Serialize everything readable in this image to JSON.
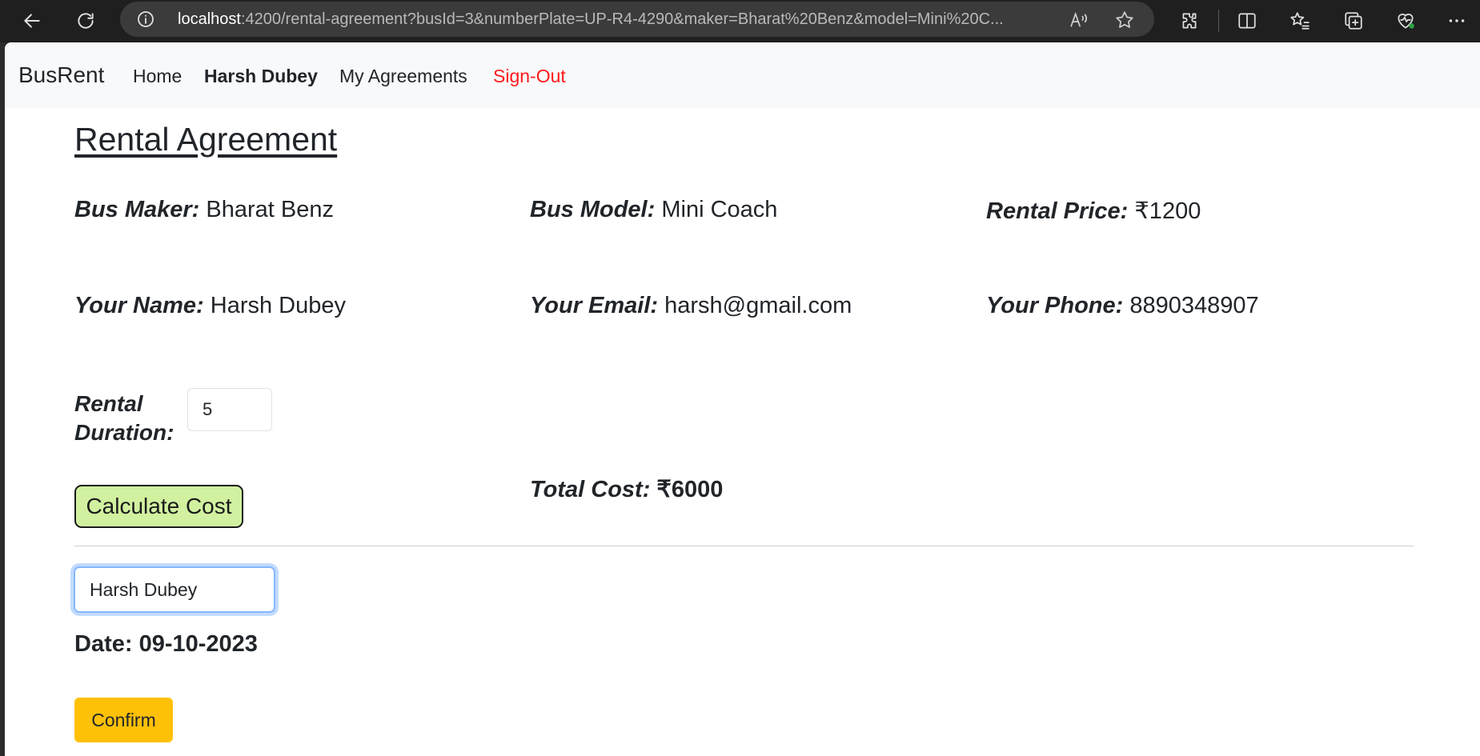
{
  "browser": {
    "url_host": "localhost",
    "url_rest": ":4200/rental-agreement?busId=3&numberPlate=UP-R4-4290&maker=Bharat%20Benz&model=Mini%20C..."
  },
  "navbar": {
    "brand": "BusRent",
    "home": "Home",
    "user": "Harsh Dubey",
    "agreements": "My Agreements",
    "signout": "Sign-Out"
  },
  "page": {
    "heading": "Rental Agreement",
    "bus_maker_label": "Bus Maker:",
    "bus_maker": "Bharat Benz",
    "bus_model_label": "Bus Model:",
    "bus_model": "Mini Coach",
    "rental_price_label": "Rental Price:",
    "rental_price": "₹1200",
    "name_label": "Your Name:",
    "name": "Harsh Dubey",
    "email_label": "Your Email:",
    "email": "harsh@gmail.com",
    "phone_label": "Your Phone:",
    "phone": "8890348907",
    "duration_label_line1": "Rental",
    "duration_label_line2": "Duration:",
    "duration_value": "5",
    "calc_button": "Calculate Cost",
    "total_label": "Total Cost:",
    "total_value": "₹6000",
    "signature_value": "Harsh Dubey",
    "date_text": "Date: 09-10-2023",
    "confirm_button": "Confirm"
  },
  "colors": {
    "signout": "#ff1a1a",
    "calc_button_bg": "#d1f1a0",
    "confirm_button_bg": "#ffc107"
  }
}
